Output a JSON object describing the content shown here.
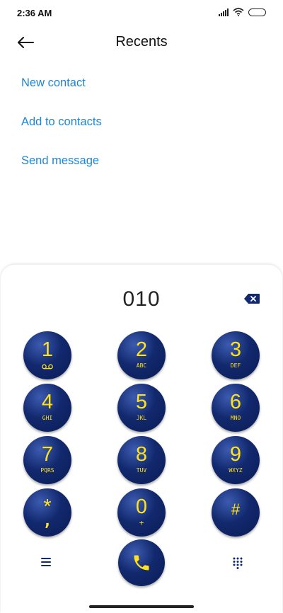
{
  "status_bar": {
    "time": "2:36 AM"
  },
  "header": {
    "title": "Recents"
  },
  "actions": [
    {
      "label": "New contact"
    },
    {
      "label": "Add to contacts"
    },
    {
      "label": "Send message"
    }
  ],
  "dialer": {
    "number": "010",
    "keys": [
      {
        "digit": "1",
        "letters": ""
      },
      {
        "digit": "2",
        "letters": "ABC"
      },
      {
        "digit": "3",
        "letters": "DEF"
      },
      {
        "digit": "4",
        "letters": "GHI"
      },
      {
        "digit": "5",
        "letters": "JKL"
      },
      {
        "digit": "6",
        "letters": "MNO"
      },
      {
        "digit": "7",
        "letters": "PQRS"
      },
      {
        "digit": "8",
        "letters": "TUV"
      },
      {
        "digit": "9",
        "letters": "WXYZ"
      },
      {
        "digit": "*",
        "letters": ","
      },
      {
        "digit": "0",
        "letters": "+"
      },
      {
        "digit": "#",
        "letters": ""
      }
    ]
  },
  "theme": {
    "key_color": "#12296e",
    "key_text_color": "#ffe21a",
    "link_color": "#1b87d6"
  },
  "icons": [
    "signal-icon",
    "wifi-icon",
    "battery-icon",
    "back-arrow-icon",
    "backspace-icon",
    "voicemail-icon",
    "menu-icon",
    "phone-icon",
    "dialpad-icon"
  ]
}
